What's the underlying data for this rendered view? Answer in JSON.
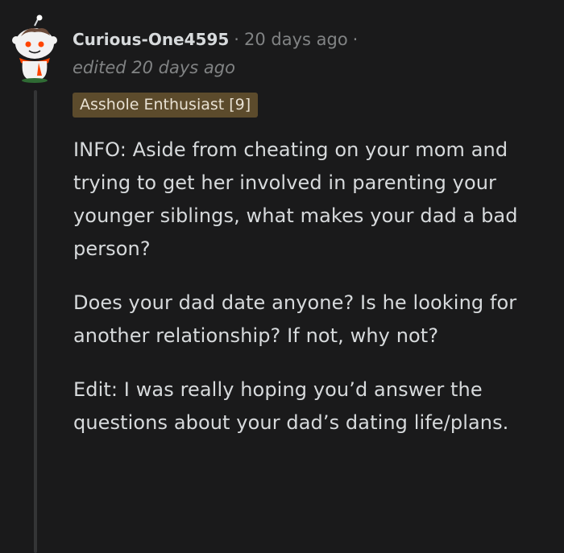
{
  "comment": {
    "avatar_icon": "snoo-avatar-icon",
    "username": "Curious-One4595",
    "separator": "·",
    "timestamp": "20 days ago",
    "trailing_separator": "·",
    "edited": "edited 20 days ago",
    "flair": "Asshole Enthusiast [9]",
    "paragraphs": [
      "INFO: Aside from cheating on your mom and trying to get her involved in parenting your younger siblings, what makes your dad a bad person?",
      "Does your dad date anyone? Is he looking for another relationship? If not, why not?",
      "Edit: I was really hoping you’d answer the questions about your dad’s dating life/plans."
    ]
  },
  "colors": {
    "background": "#1a1a1b",
    "text": "#d7dadc",
    "muted": "#818384",
    "flair_bg": "#5c4b2c",
    "thread_line": "#343536"
  }
}
